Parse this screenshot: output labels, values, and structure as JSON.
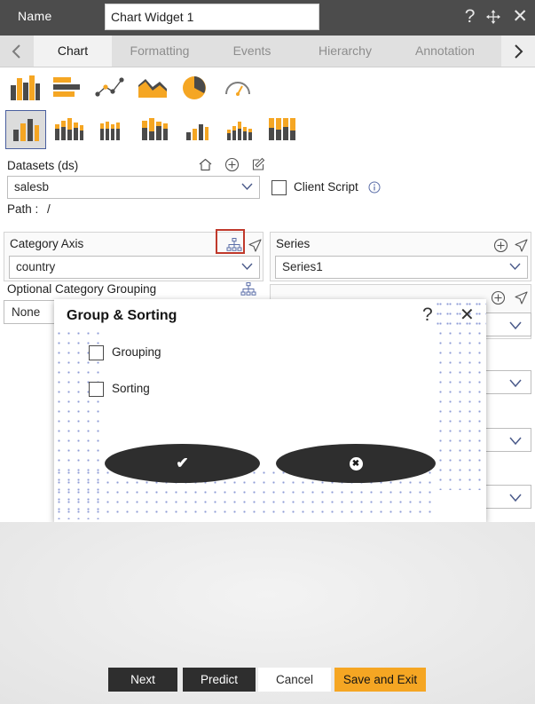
{
  "titlebar": {
    "name_label": "Name",
    "widget_name_value": "Chart Widget 1",
    "widget_name_placeholder": "Chart Widget 1",
    "help_icon": "question-mark-icon",
    "move_icon": "move-cross-icon",
    "close_icon": "close-x-icon",
    "bg_color": "#4c4c4c"
  },
  "tabs": {
    "prev_arrow": "chevron-left-icon",
    "next_arrow": "chevron-right-icon",
    "items": [
      {
        "label": "Chart",
        "active": true
      },
      {
        "label": "Formatting",
        "active": false
      },
      {
        "label": "Events",
        "active": false
      },
      {
        "label": "Hierarchy",
        "active": false
      },
      {
        "label": "Annotation",
        "active": false
      }
    ]
  },
  "chart_types_row1": [
    {
      "name": "column-chart-icon",
      "selected": true
    },
    {
      "name": "bar-chart-icon",
      "selected": false
    },
    {
      "name": "scatter-line-chart-icon",
      "selected": false
    },
    {
      "name": "area-chart-icon",
      "selected": false
    },
    {
      "name": "pie-chart-icon",
      "selected": false
    },
    {
      "name": "gauge-chart-icon",
      "selected": false
    }
  ],
  "chart_types_row2": [
    {
      "name": "column-plain-icon",
      "selected": true
    },
    {
      "name": "column-grouped-icon",
      "selected": false
    },
    {
      "name": "column-thin-grouped-icon",
      "selected": false
    },
    {
      "name": "column-stacked-icon",
      "selected": false
    },
    {
      "name": "column-small-icon",
      "selected": false
    },
    {
      "name": "column-cluster-icon",
      "selected": false
    },
    {
      "name": "column-100-stacked-icon",
      "selected": false
    }
  ],
  "datasets": {
    "label": "Datasets (ds)",
    "home_icon": "home-icon",
    "add_icon": "plus-circle-icon",
    "edit_icon": "edit-pencil-icon",
    "selected_value": "salesb",
    "path_label": "Path :",
    "path_value": "/",
    "client_script_label": "Client Script",
    "client_script_checked": false,
    "client_script_info_icon": "info-circle-icon"
  },
  "category_axis": {
    "title": "Category Axis",
    "hierarchy_icon": "hierarchy-org-chart-icon",
    "hierarchy_icon_highlighted": true,
    "highlight_color": "#c0392b",
    "send_icon": "send-arrow-icon",
    "selected_value": "country"
  },
  "series": {
    "title": "Series",
    "add_icon": "plus-circle-icon",
    "send_icon": "send-arrow-icon",
    "selected_value": "Series1"
  },
  "optional_category_grouping": {
    "label": "Optional Category Grouping",
    "hierarchy_icon": "hierarchy-org-chart-icon",
    "selected_value": "None"
  },
  "right_column": {
    "add_icon": "plus-circle-icon",
    "send_icon": "send-arrow-icon",
    "chevron_icon": "chevron-down-icon",
    "dropdown_count": 4
  },
  "modal": {
    "title": "Group & Sorting",
    "help_icon": "question-mark-icon",
    "close_icon": "close-x-icon",
    "checkboxes": [
      {
        "label": "Grouping",
        "checked": false
      },
      {
        "label": "Sorting",
        "checked": false
      }
    ],
    "confirm_icon": "check-icon",
    "cancel_icon": "x-circle-icon",
    "button_color": "#2e2e2e",
    "dot_color": "#8e9bd6"
  },
  "footer": {
    "buttons": [
      {
        "label": "Next",
        "style": "dark"
      },
      {
        "label": "Predict",
        "style": "dark"
      },
      {
        "label": "Cancel",
        "style": "plain"
      },
      {
        "label": "Save and Exit",
        "style": "accent"
      }
    ],
    "accent_color": "#f5a623"
  }
}
